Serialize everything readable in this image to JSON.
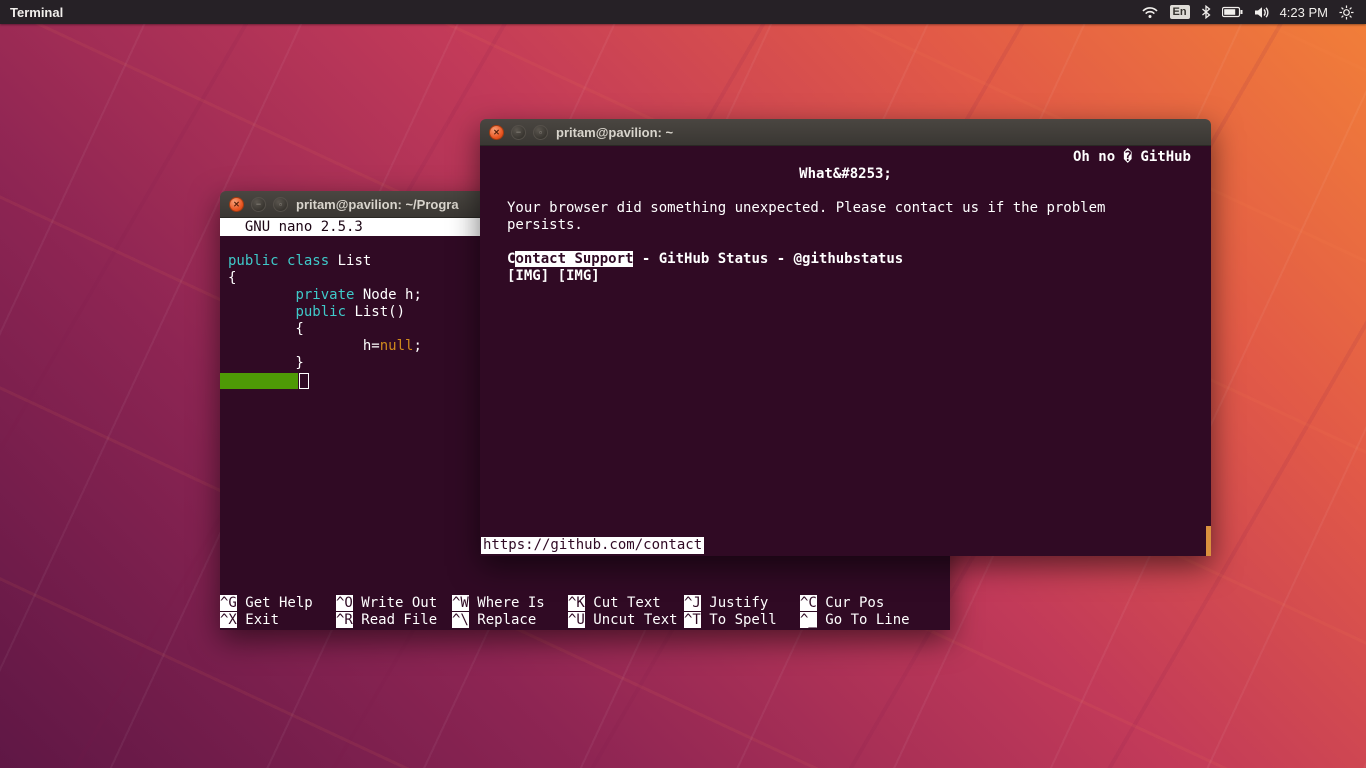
{
  "topbar": {
    "app_title": "Terminal",
    "keyboard_layout": "En",
    "time": "4:23 PM",
    "icons": [
      "network-icon",
      "keyboard-layout-indicator",
      "bluetooth-icon",
      "battery-icon",
      "volume-icon",
      "clock",
      "session-menu-icon"
    ]
  },
  "nano_window": {
    "title": "pritam@pavilion: ~/Progra",
    "nano_header": "  GNU nano 2.5.3",
    "code_lines": [
      {
        "segments": [
          {
            "text": "public",
            "color": "keyword"
          },
          {
            "text": " ",
            "color": "plain"
          },
          {
            "text": "class",
            "color": "keyword"
          },
          {
            "text": " List",
            "color": "plain"
          }
        ]
      },
      {
        "segments": [
          {
            "text": "{",
            "color": "plain"
          }
        ]
      },
      {
        "segments": [
          {
            "text": "        ",
            "color": "plain"
          },
          {
            "text": "private",
            "color": "keyword"
          },
          {
            "text": " Node h;",
            "color": "plain"
          }
        ]
      },
      {
        "segments": [
          {
            "text": "        ",
            "color": "plain"
          },
          {
            "text": "public",
            "color": "keyword"
          },
          {
            "text": " List()",
            "color": "plain"
          }
        ]
      },
      {
        "segments": [
          {
            "text": "        {",
            "color": "plain"
          }
        ]
      },
      {
        "segments": [
          {
            "text": "                h=",
            "color": "plain"
          },
          {
            "text": "null",
            "color": "literal"
          },
          {
            "text": ";",
            "color": "plain"
          }
        ]
      },
      {
        "segments": [
          {
            "text": "        }",
            "color": "plain"
          }
        ]
      }
    ],
    "shortcuts": [
      [
        {
          "key": "^G",
          "label": "Get Help"
        },
        {
          "key": "^O",
          "label": "Write Out"
        },
        {
          "key": "^W",
          "label": "Where Is"
        },
        {
          "key": "^K",
          "label": "Cut Text"
        },
        {
          "key": "^J",
          "label": "Justify"
        },
        {
          "key": "^C",
          "label": "Cur Pos"
        }
      ],
      [
        {
          "key": "^X",
          "label": "Exit"
        },
        {
          "key": "^R",
          "label": "Read File"
        },
        {
          "key": "^\\",
          "label": "Replace"
        },
        {
          "key": "^U",
          "label": "Uncut Text"
        },
        {
          "key": "^T",
          "label": "To Spell"
        },
        {
          "key": "^_",
          "label": "Go To Line"
        }
      ]
    ]
  },
  "browser_window": {
    "title": "pritam@pavilion: ~",
    "header_right": "Oh no � GitHub",
    "heading": "What&#8253;",
    "body_line1": "Your browser did something unexpected. Please contact us if the problem",
    "body_line2": "persists.",
    "link_cursor_char": "C",
    "link_selected": "ontact Support",
    "links_rest": " - GitHub Status - @githubstatus",
    "images_line": "[IMG] [IMG]",
    "status_url": "https://github.com/contact"
  },
  "colors": {
    "terminal_background": "#300a24",
    "accent_orange": "#e95420",
    "selection_green": "#4e9a06",
    "syntax_keyword": "#3fc9c9",
    "syntax_literal": "#cf8a1d",
    "wallpaper_purple": "#5f1745",
    "wallpaper_orange": "#f28038"
  }
}
